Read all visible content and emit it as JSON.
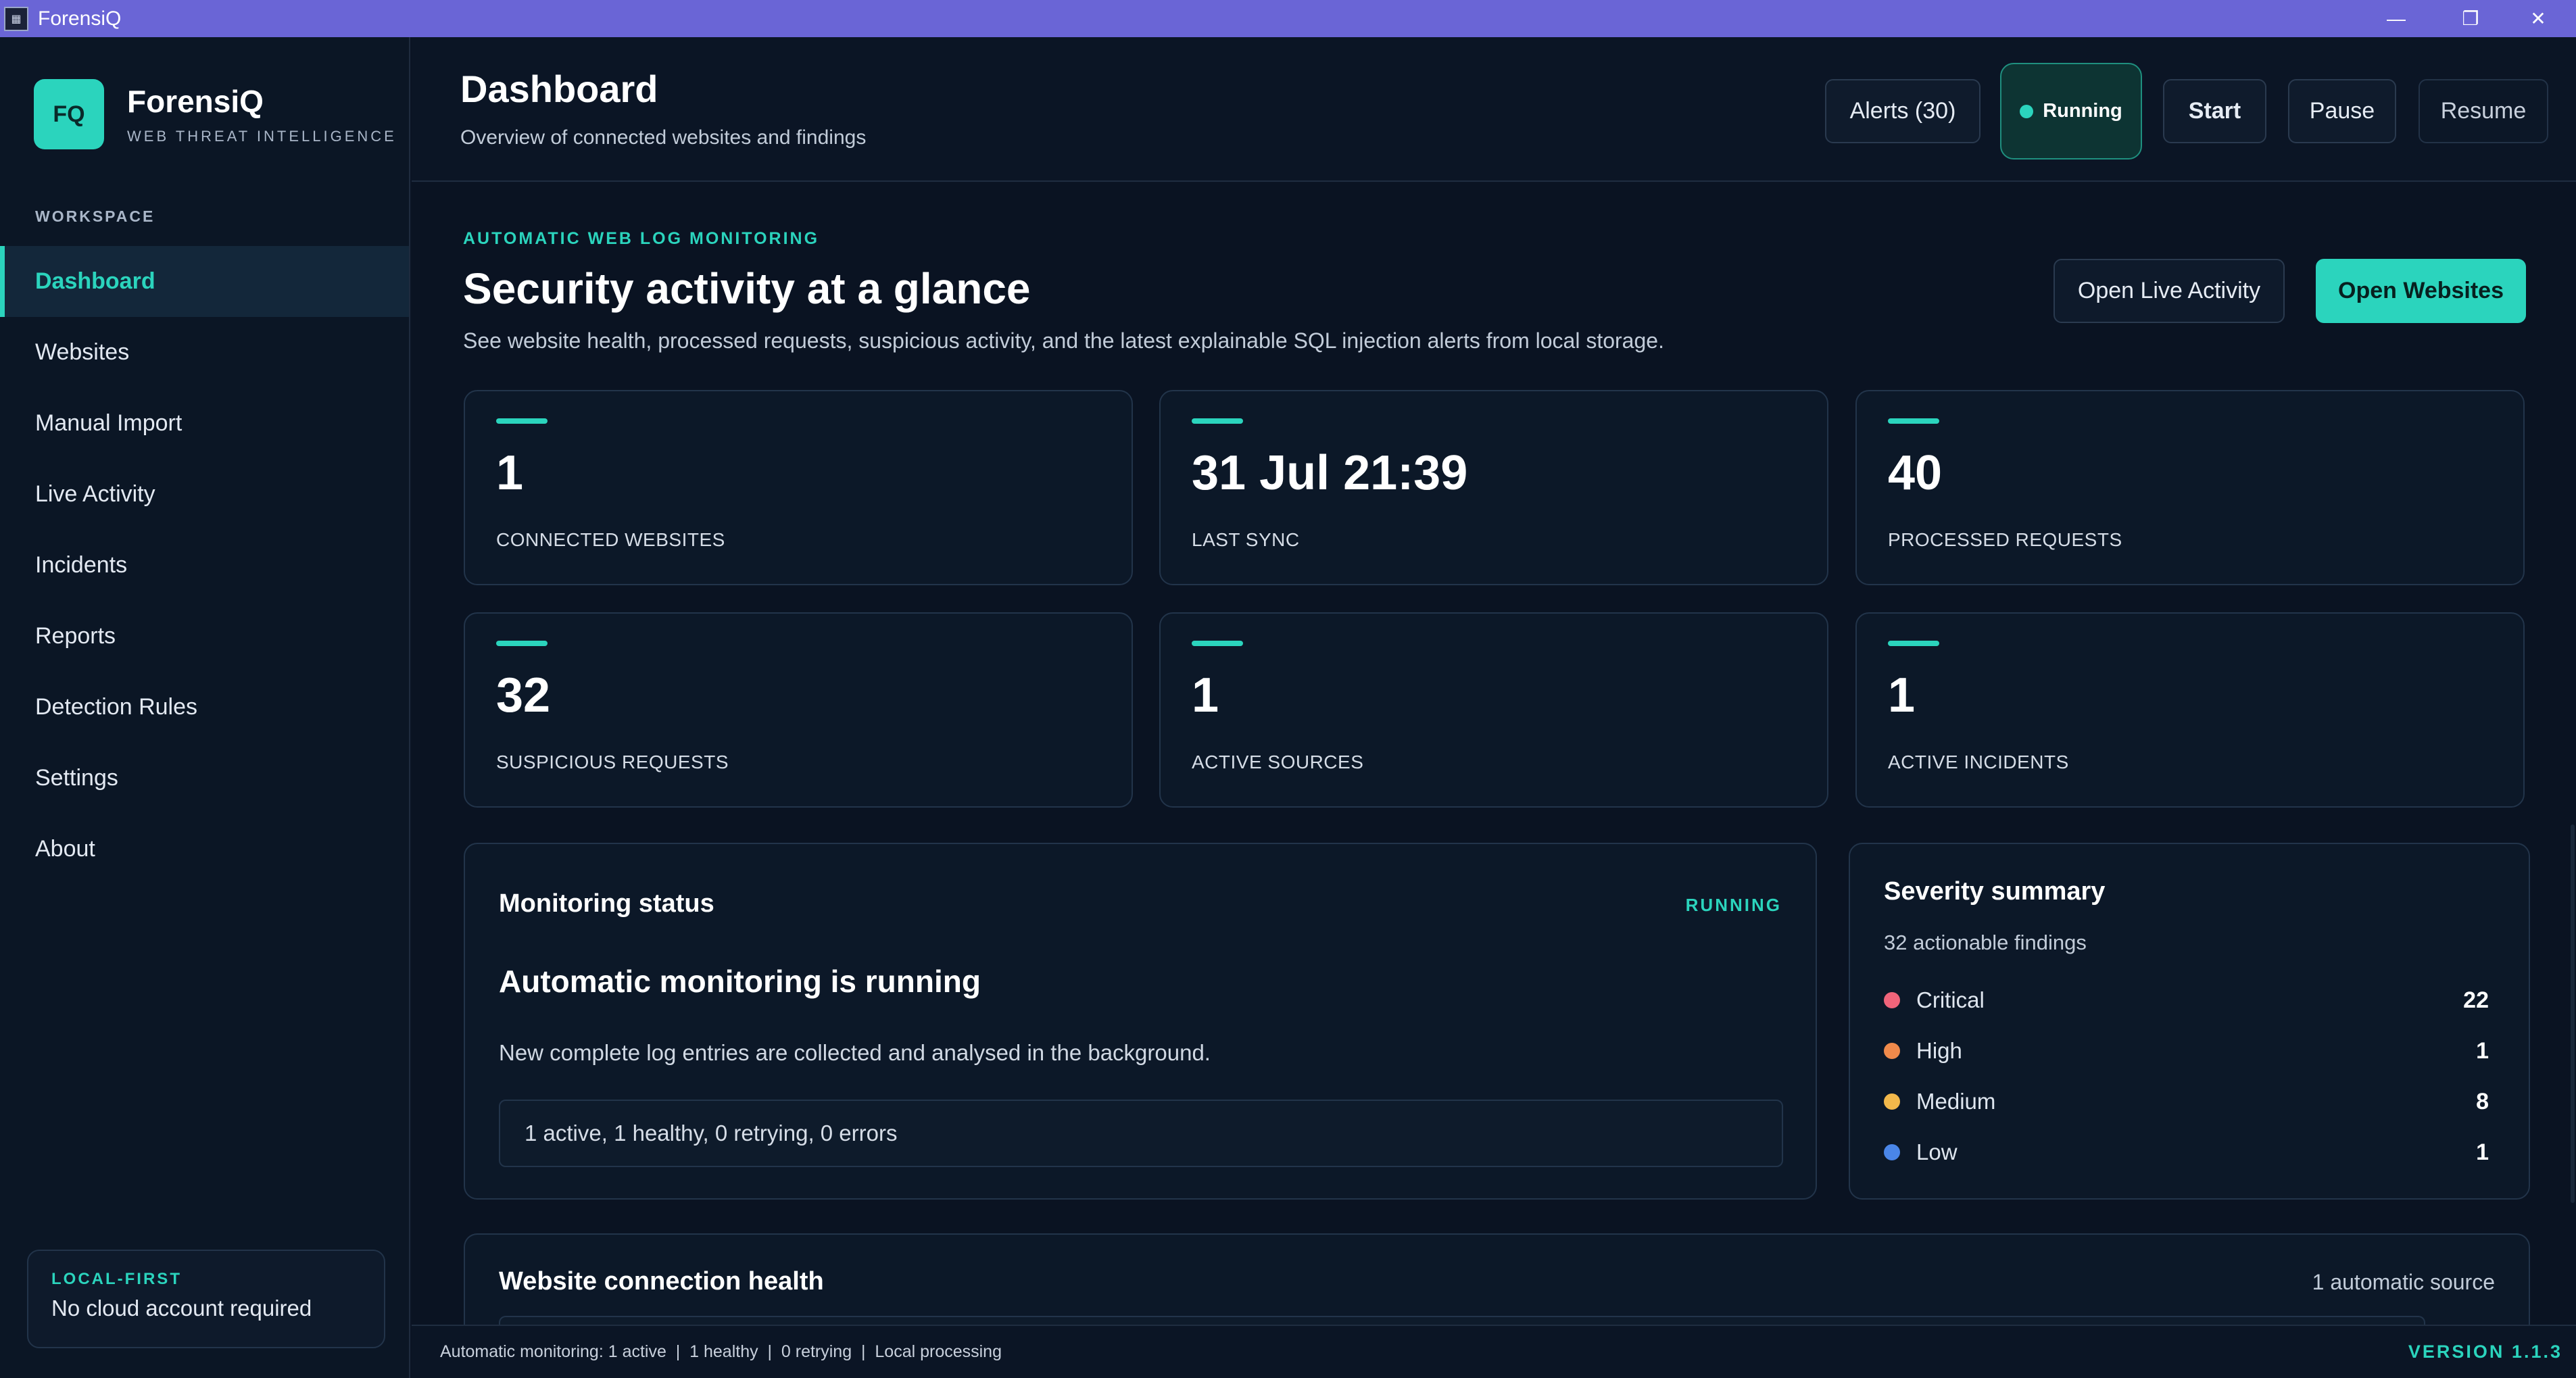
{
  "window": {
    "title": "ForensiQ"
  },
  "sidebar": {
    "logo_initials": "FQ",
    "brand_name": "ForensiQ",
    "brand_tagline": "WEB THREAT INTELLIGENCE",
    "section_label": "WORKSPACE",
    "items": [
      {
        "label": "Dashboard",
        "active": true
      },
      {
        "label": "Websites"
      },
      {
        "label": "Manual Import"
      },
      {
        "label": "Live Activity"
      },
      {
        "label": "Incidents"
      },
      {
        "label": "Reports"
      },
      {
        "label": "Detection Rules"
      },
      {
        "label": "Settings"
      },
      {
        "label": "About"
      }
    ],
    "local_card": {
      "label": "LOCAL-FIRST",
      "text": "No cloud account required"
    }
  },
  "header": {
    "title": "Dashboard",
    "subtitle": "Overview of connected websites and findings",
    "alerts_label": "Alerts (30)",
    "status_label": "Running",
    "start_label": "Start",
    "pause_label": "Pause",
    "resume_label": "Resume"
  },
  "hero": {
    "eyebrow": "AUTOMATIC WEB LOG MONITORING",
    "title": "Security activity at a glance",
    "subtitle": "See website health, processed requests, suspicious activity, and the latest explainable SQL injection alerts from local storage.",
    "open_live_label": "Open Live Activity",
    "open_websites_label": "Open Websites"
  },
  "stats": [
    {
      "value": "1",
      "label": "CONNECTED WEBSITES"
    },
    {
      "value": "31 Jul 21:39",
      "label": "LAST SYNC"
    },
    {
      "value": "40",
      "label": "PROCESSED REQUESTS"
    },
    {
      "value": "32",
      "label": "SUSPICIOUS REQUESTS"
    },
    {
      "value": "1",
      "label": "ACTIVE SOURCES"
    },
    {
      "value": "1",
      "label": "ACTIVE INCIDENTS"
    }
  ],
  "monitoring": {
    "title": "Monitoring status",
    "state": "RUNNING",
    "headline": "Automatic monitoring is running",
    "description": "New complete log entries are collected and analysed in the background.",
    "summary": "1 active, 1 healthy, 0 retrying, 0 errors"
  },
  "severity": {
    "title": "Severity summary",
    "subtitle": "32 actionable findings",
    "rows": [
      {
        "name": "Critical",
        "count": "22",
        "color": "#f0647a"
      },
      {
        "name": "High",
        "count": "1",
        "color": "#f08a4b"
      },
      {
        "name": "Medium",
        "count": "8",
        "color": "#f2b84b"
      },
      {
        "name": "Low",
        "count": "1",
        "color": "#4a86e8"
      }
    ]
  },
  "health": {
    "title": "Website connection health",
    "right_text": "1 automatic source"
  },
  "statusbar": {
    "text": "Automatic monitoring: 1 active  |  1 healthy  |  0 retrying  |  Local processing",
    "version": "VERSION 1.1.3"
  },
  "colors": {
    "accent": "#2bd4bd",
    "titlebar": "#6a65d6",
    "background": "#0b1424"
  }
}
